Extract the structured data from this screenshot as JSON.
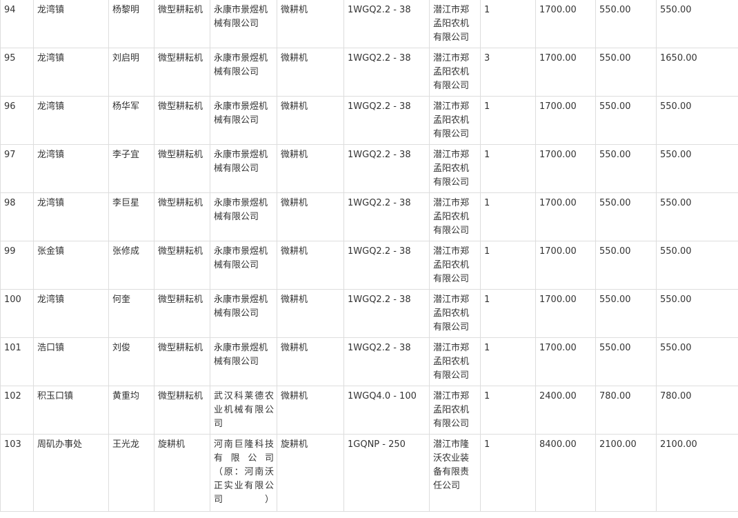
{
  "rows": [
    {
      "no": "94",
      "town": "龙湾镇",
      "name": "杨黎明",
      "category": "微型耕耘机",
      "maker": "永康市景煜机械有限公司",
      "type": "微耕机",
      "model": "1WGQ2.2 - 38",
      "dealer": "潜江市郑孟阳农机有限公司",
      "qty": "1",
      "price": "1700.00",
      "unit_subsidy": "550.00",
      "total_subsidy": "550.00"
    },
    {
      "no": "95",
      "town": "龙湾镇",
      "name": "刘启明",
      "category": "微型耕耘机",
      "maker": "永康市景煜机械有限公司",
      "type": "微耕机",
      "model": "1WGQ2.2 - 38",
      "dealer": "潜江市郑孟阳农机有限公司",
      "qty": "3",
      "price": "1700.00",
      "unit_subsidy": "550.00",
      "total_subsidy": "1650.00"
    },
    {
      "no": "96",
      "town": "龙湾镇",
      "name": "杨华军",
      "category": "微型耕耘机",
      "maker": "永康市景煜机械有限公司",
      "type": "微耕机",
      "model": "1WGQ2.2 - 38",
      "dealer": "潜江市郑孟阳农机有限公司",
      "qty": "1",
      "price": "1700.00",
      "unit_subsidy": "550.00",
      "total_subsidy": "550.00"
    },
    {
      "no": "97",
      "town": "龙湾镇",
      "name": "李子宜",
      "category": "微型耕耘机",
      "maker": "永康市景煜机械有限公司",
      "type": "微耕机",
      "model": "1WGQ2.2 - 38",
      "dealer": "潜江市郑孟阳农机有限公司",
      "qty": "1",
      "price": "1700.00",
      "unit_subsidy": "550.00",
      "total_subsidy": "550.00"
    },
    {
      "no": "98",
      "town": "龙湾镇",
      "name": "李巨星",
      "category": "微型耕耘机",
      "maker": "永康市景煜机械有限公司",
      "type": "微耕机",
      "model": "1WGQ2.2 - 38",
      "dealer": "潜江市郑孟阳农机有限公司",
      "qty": "1",
      "price": "1700.00",
      "unit_subsidy": "550.00",
      "total_subsidy": "550.00"
    },
    {
      "no": "99",
      "town": "张金镇",
      "name": "张修成",
      "category": "微型耕耘机",
      "maker": "永康市景煜机械有限公司",
      "type": "微耕机",
      "model": "1WGQ2.2 - 38",
      "dealer": "潜江市郑孟阳农机有限公司",
      "qty": "1",
      "price": "1700.00",
      "unit_subsidy": "550.00",
      "total_subsidy": "550.00"
    },
    {
      "no": "100",
      "town": "龙湾镇",
      "name": "何奎",
      "category": "微型耕耘机",
      "maker": "永康市景煜机械有限公司",
      "type": "微耕机",
      "model": "1WGQ2.2 - 38",
      "dealer": "潜江市郑孟阳农机有限公司",
      "qty": "1",
      "price": "1700.00",
      "unit_subsidy": "550.00",
      "total_subsidy": "550.00"
    },
    {
      "no": "101",
      "town": "浩口镇",
      "name": "刘俊",
      "category": "微型耕耘机",
      "maker": "永康市景煜机械有限公司",
      "type": "微耕机",
      "model": "1WGQ2.2 - 38",
      "dealer": "潜江市郑孟阳农机有限公司",
      "qty": "1",
      "price": "1700.00",
      "unit_subsidy": "550.00",
      "total_subsidy": "550.00"
    },
    {
      "no": "102",
      "town": "积玉口镇",
      "name": "黄重均",
      "category": "微型耕耘机",
      "maker": "武汉科莱德农业机械有限公司",
      "type": "微耕机",
      "model": "1WGQ4.0 - 100",
      "dealer": "潜江市郑孟阳农机有限公司",
      "qty": "1",
      "price": "2400.00",
      "unit_subsidy": "780.00",
      "total_subsidy": "780.00"
    },
    {
      "no": "103",
      "town": "周矶办事处",
      "name": "王光龙",
      "category": "旋耕机",
      "maker": "河南巨隆科技有限公司（原：河南沃正实业有限公司）",
      "type": "旋耕机",
      "model": "1GQNP - 250",
      "dealer": "潜江市隆沃农业装备有限责任公司",
      "qty": "1",
      "price": "8400.00",
      "unit_subsidy": "2100.00",
      "total_subsidy": "2100.00"
    }
  ]
}
